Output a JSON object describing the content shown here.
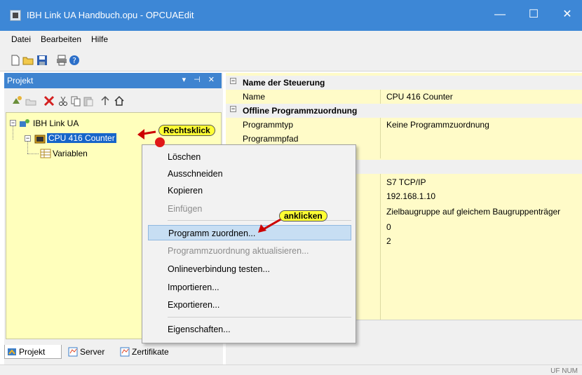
{
  "window": {
    "title": "IBH Link UA Handbuch.opu - OPCUAEdit",
    "minimize": "—",
    "maximize": "☐",
    "close": "✕"
  },
  "menu": [
    "Datei",
    "Bearbeiten",
    "Hilfe"
  ],
  "toolbar_icons": [
    "new-icon",
    "open-icon",
    "save-icon",
    "print-icon",
    "help-icon"
  ],
  "left_pane": {
    "title": "Projekt",
    "controls": "▾ ⊣ ✕",
    "tree_toolbar_icons": [
      "add-device-icon",
      "add-folder-icon",
      "delete-icon",
      "cut-icon",
      "copy-icon",
      "paste-icon",
      "move-up-icon",
      "home-icon"
    ],
    "tree": [
      {
        "label": "IBH Link UA",
        "icon": "network-device-icon"
      },
      {
        "label": "CPU 416 Counter",
        "icon": "plc-icon"
      },
      {
        "label": "Variablen",
        "icon": "table-icon"
      }
    ],
    "tabs": [
      "Projekt",
      "Server",
      "Zertifikate"
    ]
  },
  "properties": [
    {
      "type": "group",
      "name": "Name der Steuerung"
    },
    {
      "type": "row",
      "name": "Name",
      "value": "CPU 416 Counter"
    },
    {
      "type": "group",
      "name": "Offline Programmzuordnung"
    },
    {
      "type": "row",
      "name": "Programmtyp",
      "value": "Keine Programmzuordnung"
    },
    {
      "type": "row",
      "name": "Programmpfad",
      "value": ""
    },
    {
      "type": "row",
      "name": "",
      "value": ""
    },
    {
      "type": "group",
      "name": ""
    },
    {
      "type": "row",
      "name": "",
      "value": "S7 TCP/IP"
    },
    {
      "type": "row",
      "name": "",
      "value": "192.168.1.10"
    },
    {
      "type": "row",
      "name": "",
      "value": "Zielbaugruppe auf gleichem Baugruppenträger"
    },
    {
      "type": "row",
      "name": "",
      "value": "0"
    },
    {
      "type": "row",
      "name": "",
      "value": "2"
    }
  ],
  "context_menu": [
    {
      "label": "Löschen",
      "state": "normal"
    },
    {
      "label": "Ausschneiden",
      "state": "normal"
    },
    {
      "label": "Kopieren",
      "state": "normal"
    },
    {
      "label": "Einfügen",
      "state": "disabled"
    },
    {
      "type": "separator"
    },
    {
      "label": "Programm zuordnen...",
      "state": "highlighted"
    },
    {
      "label": "Programmzuordnung aktualisieren...",
      "state": "disabled"
    },
    {
      "label": "Onlineverbindung testen...",
      "state": "normal"
    },
    {
      "label": "Importieren...",
      "state": "normal"
    },
    {
      "label": "Exportieren...",
      "state": "normal"
    },
    {
      "type": "separator"
    },
    {
      "label": "Eigenschaften...",
      "state": "normal"
    }
  ],
  "annotations": {
    "right_click": "Rechtsklick",
    "click": "anklicken"
  },
  "status": "UF NUM",
  "colors": {
    "titlebar": "#3d87d6",
    "tree_background": "#ffffbc",
    "grid_background": "#fffbc8",
    "selection": "#1765c9",
    "callout": "#ffff33",
    "arrow": "#cc0000"
  }
}
